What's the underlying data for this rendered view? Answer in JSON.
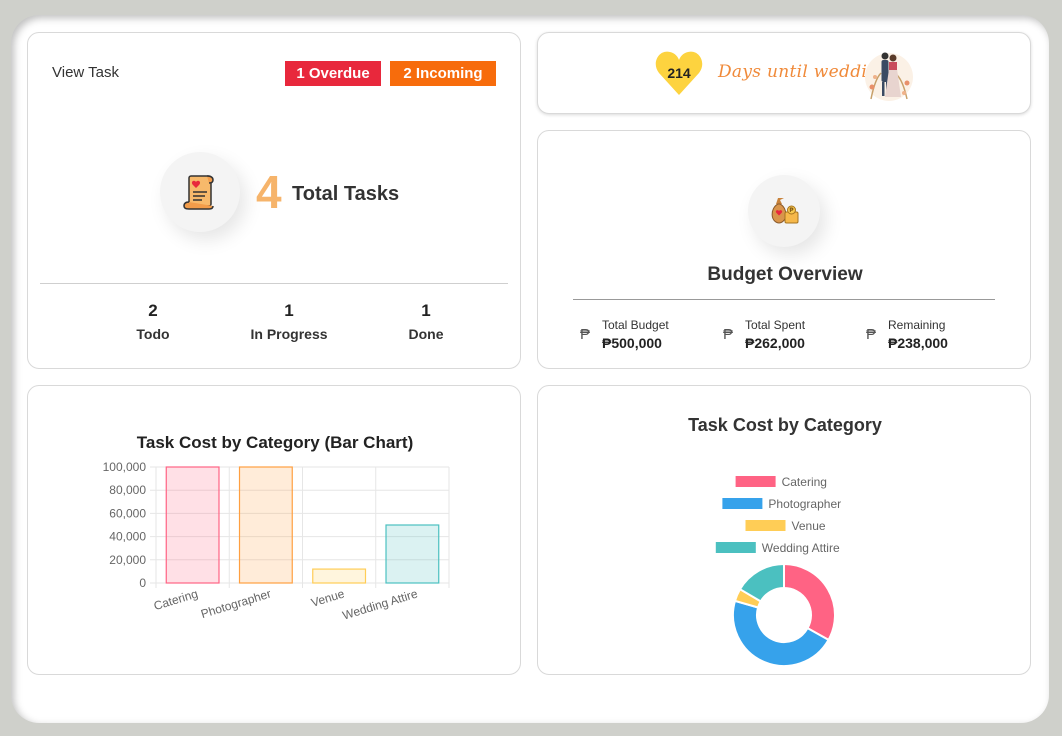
{
  "tasks": {
    "view_label": "View Task",
    "overdue_badge": "1 Overdue",
    "incoming_badge": "2 Incoming",
    "total_count": "4",
    "total_label": "Total Tasks",
    "stats": [
      {
        "value": "2",
        "label": "Todo"
      },
      {
        "value": "1",
        "label": "In Progress"
      },
      {
        "value": "1",
        "label": "Done"
      }
    ],
    "icon": "scroll-checklist-icon"
  },
  "countdown": {
    "days": "214",
    "label": "Days until wedding",
    "icon": "heart-icon",
    "image": "couple-illustration"
  },
  "budget": {
    "title": "Budget Overview",
    "icon": "money-bag-icon",
    "stats": [
      {
        "label": "Total Budget",
        "value": "₱500,000"
      },
      {
        "label": "Total Spent",
        "value": "₱262,000"
      },
      {
        "label": "Remaining",
        "value": "₱238,000"
      }
    ],
    "currency_symbol": "₱"
  },
  "colors": {
    "overdue": "#e8283c",
    "incoming": "#f76c0c",
    "accent_number": "#f6b46b",
    "heart": "#fdd33f",
    "days_text": "#f08a3a"
  },
  "chart_data": [
    {
      "type": "bar",
      "title": "Task Cost by Category (Bar Chart)",
      "categories": [
        "Catering",
        "Photographer",
        "Venue",
        "Wedding Attire"
      ],
      "values": [
        100000,
        100000,
        12000,
        50000
      ],
      "ylim": [
        0,
        100000
      ],
      "yticks": [
        "0",
        "20,000",
        "40,000",
        "60,000",
        "80,000",
        "100,000"
      ],
      "colors": [
        "#ff6384",
        "#ff9f40",
        "#ffcd56",
        "#4bc0c0"
      ],
      "grid": true
    },
    {
      "type": "pie",
      "title": "Task Cost by Category",
      "categories": [
        "Catering",
        "Photographer",
        "Venue",
        "Wedding Attire"
      ],
      "values": [
        100000,
        140000,
        12000,
        50000
      ],
      "colors": [
        "#ff6384",
        "#36a2eb",
        "#ffcd56",
        "#4bc0c0"
      ],
      "legend": "top"
    }
  ]
}
